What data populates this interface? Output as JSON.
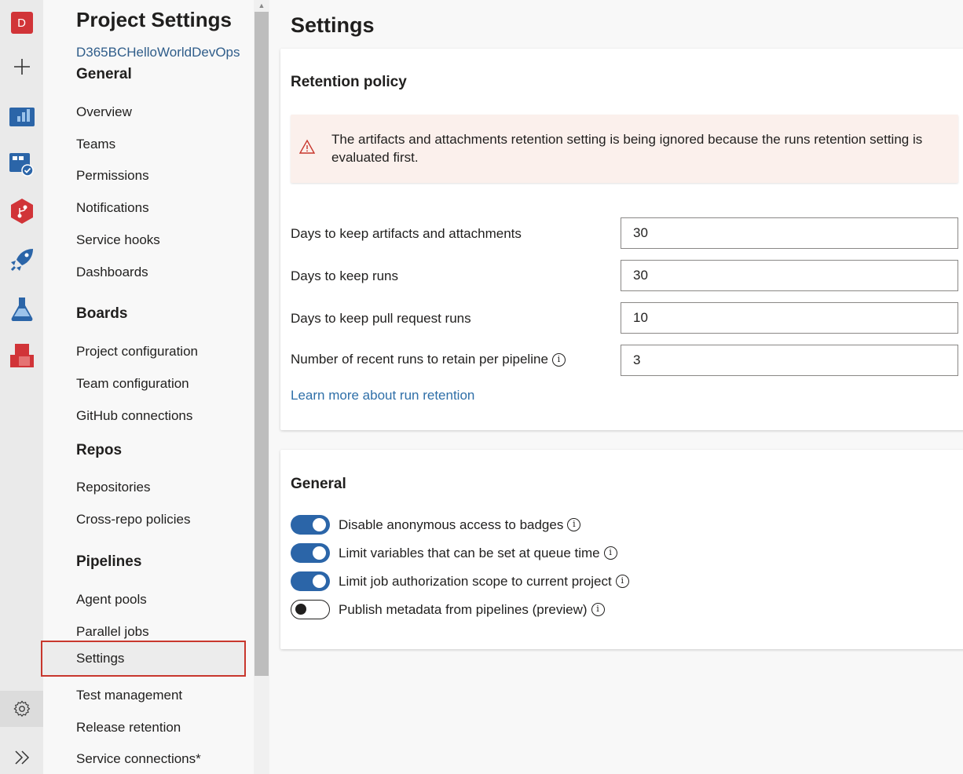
{
  "rail": {
    "org_initial": "D",
    "items": [
      "add-icon",
      "overview-icon",
      "boards-icon",
      "repos-icon",
      "pipelines-icon",
      "test-plans-icon",
      "artifacts-icon"
    ],
    "settings_icon": "gear-icon",
    "expand_icon": "double-chevron-icon"
  },
  "nav": {
    "title": "Project Settings",
    "project": "D365BCHelloWorldDevOps",
    "sections": {
      "general": "General",
      "boards": "Boards",
      "repos": "Repos",
      "pipelines": "Pipelines"
    },
    "items": {
      "overview": "Overview",
      "teams": "Teams",
      "permissions": "Permissions",
      "notifications": "Notifications",
      "service_hooks": "Service hooks",
      "dashboards": "Dashboards",
      "project_configuration": "Project configuration",
      "team_configuration": "Team configuration",
      "github_connections": "GitHub connections",
      "repositories": "Repositories",
      "cross_repo_policies": "Cross-repo policies",
      "agent_pools": "Agent pools",
      "parallel_jobs": "Parallel jobs",
      "settings": "Settings",
      "test_management": "Test management",
      "release_retention": "Release retention",
      "service_connections": "Service connections*"
    }
  },
  "main": {
    "title": "Settings",
    "retention": {
      "title": "Retention policy",
      "warning": "The artifacts and attachments retention setting is being ignored because the runs retention setting is evaluated first.",
      "fields": [
        {
          "label": "Days to keep artifacts and attachments",
          "value": "30"
        },
        {
          "label": "Days to keep runs",
          "value": "30"
        },
        {
          "label": "Days to keep pull request runs",
          "value": "10"
        },
        {
          "label": "Number of recent runs to retain per pipeline",
          "value": "3"
        }
      ],
      "link": "Learn more about run retention"
    },
    "general": {
      "title": "General",
      "toggles": [
        {
          "label": "Disable anonymous access to badges",
          "on": true
        },
        {
          "label": "Limit variables that can be set at queue time",
          "on": true
        },
        {
          "label": "Limit job authorization scope to current project",
          "on": true
        },
        {
          "label": "Publish metadata from pipelines (preview)",
          "on": false
        }
      ]
    }
  },
  "colors": {
    "accent": "#2b65a8",
    "highlight_border": "#c8372d",
    "warning_bg": "#fbf0ec",
    "org_badge": "#d13438"
  }
}
